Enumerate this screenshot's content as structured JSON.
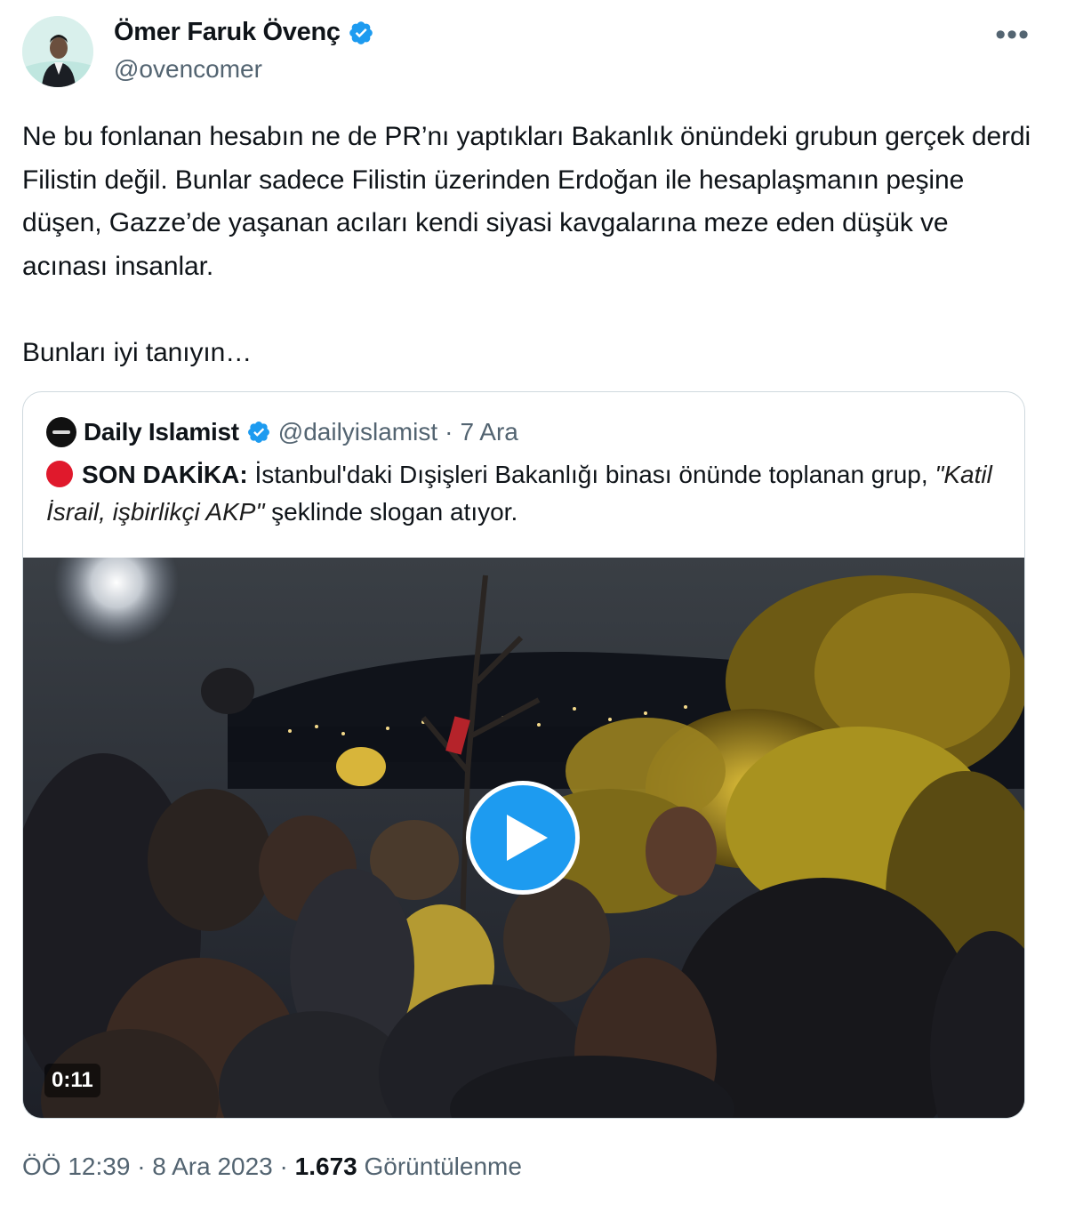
{
  "author": {
    "name": "Ömer Faruk Övenç",
    "handle": "@ovencomer",
    "verified": true
  },
  "more_icon": "more-horizontal-icon",
  "tweet": {
    "paragraph_1": "Ne bu fonlanan hesabın ne de PR’nı yaptıkları Bakanlık önündeki grubun gerçek derdi Filistin değil. Bunlar sadece Filistin üzerinden Erdoğan ile hesaplaşmanın peşine düşen, Gazze’de yaşanan acıları kendi siyasi kavgalarına meze eden düşük ve acınası insanlar.",
    "paragraph_2": "Bunları iyi tanıyın…"
  },
  "quoted": {
    "name": "Daily Islamist",
    "handle": "@dailyislamist",
    "separator": "·",
    "date": "7 Ara",
    "label": "SON DAKİKA:",
    "text_1": "İstanbul'daki Dışişleri Bakanlığı binası önünde toplanan grup,",
    "quote": "\"Katil İsrail, işbirlikçi AKP\"",
    "text_2": "şeklinde slogan atıyor.",
    "video": {
      "duration": "0:11",
      "play_icon": "play-icon"
    }
  },
  "meta": {
    "time": "ÖÖ 12:39",
    "sep1": "·",
    "date": "8 Ara 2023",
    "sep2": "·",
    "views_count": "1.673",
    "views_label": "Görüntülenme"
  },
  "colors": {
    "verified_blue": "#1d9bf0",
    "secondary_text": "#536471",
    "primary_text": "#0f1419",
    "breaking_red": "#e0192c"
  }
}
